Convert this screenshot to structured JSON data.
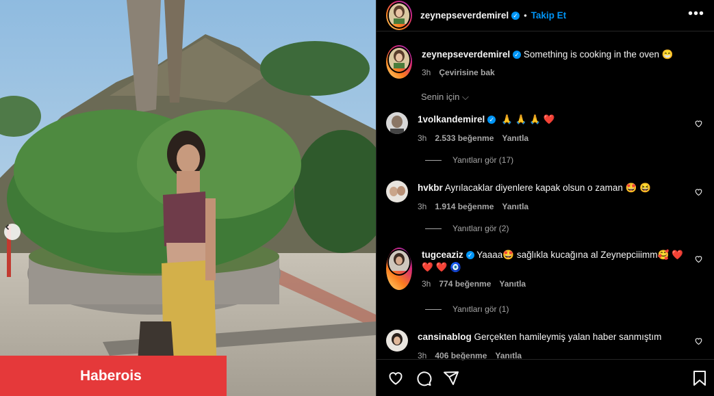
{
  "post": {
    "watermark": "Haberois"
  },
  "header": {
    "username": "zeynepseverdemirel",
    "separator": "•",
    "follow_label": "Takip Et",
    "more_icon": "more-horizontal-icon"
  },
  "caption": {
    "username": "zeynepseverdemirel",
    "text": "Something is cooking in the oven 😁",
    "time": "3h",
    "translate_label": "Çevirisine bak"
  },
  "sort_label": "Senin için ⌵",
  "comments": [
    {
      "username": "1volkandemirel",
      "verified": true,
      "text": "🙏 🙏 🙏 ❤️",
      "time": "3h",
      "likes": "2.533 beğenme",
      "reply": "Yanıtla",
      "view_replies": "Yanıtları gör (17)"
    },
    {
      "username": "hvkbr",
      "verified": false,
      "text": "Ayrılacaklar diyenlere kapak olsun o zaman 🤩 😆",
      "time": "3h",
      "likes": "1.914 beğenme",
      "reply": "Yanıtla",
      "view_replies": "Yanıtları gör (2)"
    },
    {
      "username": "tugceaziz",
      "verified": true,
      "text": "Yaaaa🤩 sağlıkla kucağına al Zeynepciiimm🥰 ❤️",
      "text2": "❤️ ❤️ 🧿",
      "time": "3h",
      "likes": "774 beğenme",
      "reply": "Yanıtla",
      "view_replies": "Yanıtları gör (1)"
    },
    {
      "username": "cansinablog",
      "verified": false,
      "text": "Gerçekten hamileymiş yalan haber sanmıştım",
      "time": "3h",
      "likes": "406 beğenme",
      "reply": "Yanıtla"
    }
  ],
  "colors": {
    "accent": "#0095f6",
    "watermark_bg": "#e5393a",
    "muted": "#a8a8a8",
    "background": "#000000"
  }
}
